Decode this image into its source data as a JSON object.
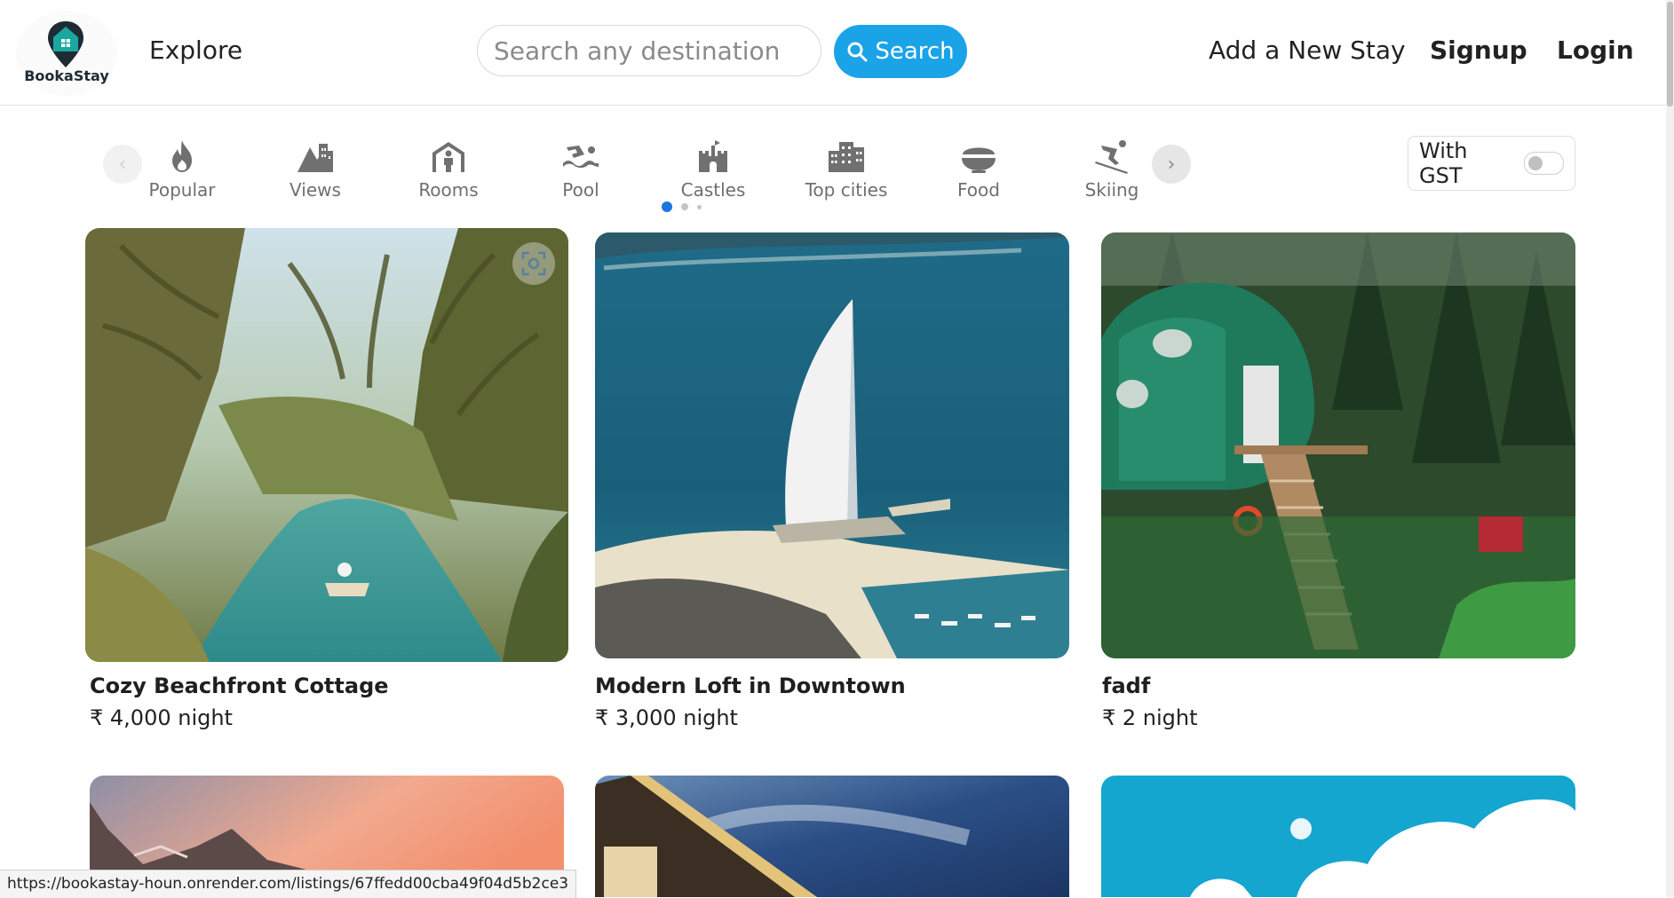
{
  "header": {
    "logo_text": "BookaStay",
    "explore": "Explore",
    "search_placeholder": "Search any destination",
    "search_button": "Search",
    "nav": {
      "add": "Add a New Stay",
      "signup": "Signup",
      "login": "Login"
    }
  },
  "categories": [
    {
      "label": "Popular",
      "icon": "fire-icon"
    },
    {
      "label": "Views",
      "icon": "mountain-city-icon"
    },
    {
      "label": "Rooms",
      "icon": "person-shelter-icon"
    },
    {
      "label": "Pool",
      "icon": "person-swimming-icon"
    },
    {
      "label": "Castles",
      "icon": "castle-icon"
    },
    {
      "label": "Top cities",
      "icon": "city-icon"
    },
    {
      "label": "Food",
      "icon": "bowl-food-icon"
    },
    {
      "label": "Skiing",
      "icon": "person-skiing-icon"
    }
  ],
  "carousel": {
    "active_page": 1,
    "pages": 3
  },
  "gst": {
    "label": "With GST",
    "enabled": false
  },
  "listings": [
    {
      "title": "Cozy Beachfront Cottage",
      "price": "₹ 4,000 night"
    },
    {
      "title": "Modern Loft in Downtown",
      "price": "₹ 3,000 night"
    },
    {
      "title": "fadf",
      "price": "₹ 2 night"
    }
  ],
  "status_url": "https://bookastay-houn.onrender.com/listings/67ffedd00cba49f04d5b2ce3",
  "colors": {
    "accent": "#1ba3e8",
    "dot_active": "#1b75e0",
    "logo_teal": "#1aa7a0"
  }
}
